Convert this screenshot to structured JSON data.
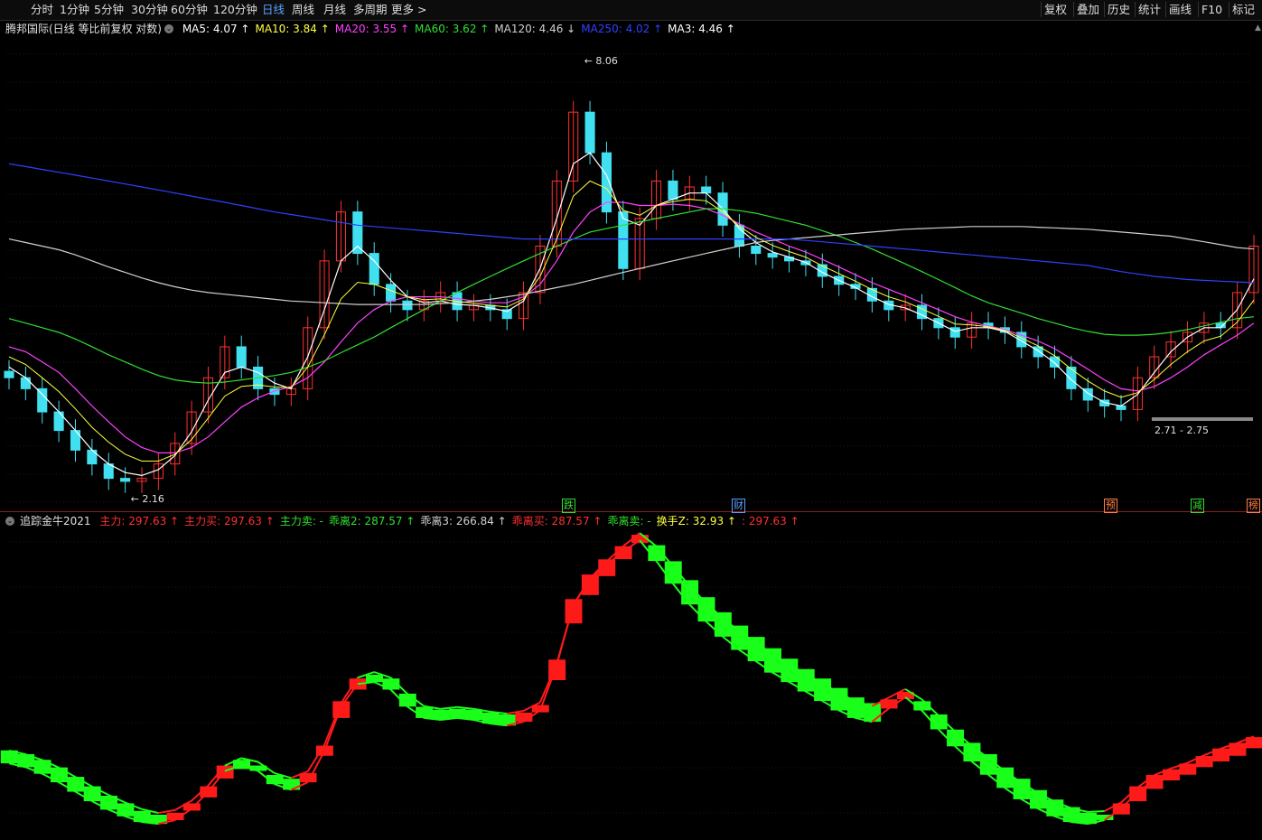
{
  "toolbar": {
    "periods": [
      "分时",
      "1分钟",
      "5分钟",
      "30分钟",
      "60分钟",
      "120分钟",
      "日线",
      "周线",
      "月线",
      "多周期",
      "更多 >"
    ],
    "active_period": "日线",
    "right_buttons": [
      "复权",
      "叠加",
      "历史",
      "统计",
      "画线",
      "F10",
      "标记"
    ]
  },
  "main_legend": {
    "title": "腾邦国际(日线 等比前复权 对数)",
    "items": [
      {
        "label": "MA5: 4.07",
        "arrow": "↑",
        "color": "#ffffff"
      },
      {
        "label": "MA10: 3.84",
        "arrow": "↑",
        "color": "#ffff40"
      },
      {
        "label": "MA20: 3.55",
        "arrow": "↑",
        "color": "#ff40ff"
      },
      {
        "label": "MA60: 3.62",
        "arrow": "↑",
        "color": "#30e030"
      },
      {
        "label": "MA120: 4.46",
        "arrow": "↓",
        "color": "#d0d0d0"
      },
      {
        "label": "MA250: 4.02",
        "arrow": "↑",
        "color": "#3040ff"
      },
      {
        "label": "MA3: 4.46",
        "arrow": "↑",
        "color": "#ffffff"
      }
    ]
  },
  "sub_legend": {
    "title": "追踪金牛2021",
    "items": [
      {
        "label": "主力: 297.63",
        "arrow": "↑",
        "color": "#ff3030"
      },
      {
        "label": "主力买: 297.63",
        "arrow": "↑",
        "color": "#ff3030"
      },
      {
        "label": "主力卖: -",
        "arrow": "",
        "color": "#30e030"
      },
      {
        "label": "乖离2: 287.57",
        "arrow": "↑",
        "color": "#30e030"
      },
      {
        "label": "乖离3: 266.84",
        "arrow": "↑",
        "color": "#d0d0d0"
      },
      {
        "label": "乖离买: 287.57",
        "arrow": "↑",
        "color": "#ff3030"
      },
      {
        "label": "乖离卖: -",
        "arrow": "",
        "color": "#30e030"
      },
      {
        "label": "换手Z: 32.93",
        "arrow": "↑",
        "color": "#ffff40"
      },
      {
        "label": ": 297.63",
        "arrow": "↑",
        "color": "#ff3030"
      }
    ]
  },
  "annotations": {
    "high": "8.06",
    "low": "2.16",
    "range": "2.71 - 2.75"
  },
  "event_marks": [
    {
      "label": "跌",
      "color": "#30e030"
    },
    {
      "label": "财",
      "color": "#5aa0ff"
    },
    {
      "label": "预",
      "color": "#ff8040"
    },
    {
      "label": "减",
      "color": "#30e030"
    },
    {
      "label": "榜",
      "color": "#ff8040"
    }
  ],
  "colors": {
    "up": "#ff3030",
    "down": "#40e0f0",
    "buy": "#ff1a1a",
    "sell": "#1aff1a"
  },
  "chart_data": {
    "type": "line",
    "title": "腾邦国际(日线 等比前复权 对数)",
    "price_ylim": [
      2.05,
      8.5
    ],
    "y_scale": "log",
    "high": 8.06,
    "low": 2.16,
    "series": [
      {
        "name": "close",
        "values": [
          3.0,
          2.9,
          2.7,
          2.55,
          2.4,
          2.3,
          2.2,
          2.18,
          2.2,
          2.3,
          2.45,
          2.7,
          3.0,
          3.3,
          3.1,
          2.9,
          2.85,
          2.9,
          3.5,
          4.3,
          5.0,
          4.4,
          4.0,
          3.8,
          3.7,
          3.8,
          3.9,
          3.7,
          3.75,
          3.7,
          3.6,
          3.9,
          4.5,
          5.5,
          6.8,
          6.0,
          5.0,
          4.2,
          4.9,
          5.5,
          5.2,
          5.4,
          5.3,
          4.8,
          4.5,
          4.4,
          4.35,
          4.3,
          4.25,
          4.1,
          4.0,
          3.95,
          3.8,
          3.7,
          3.75,
          3.6,
          3.5,
          3.4,
          3.55,
          3.5,
          3.45,
          3.3,
          3.2,
          3.1,
          2.9,
          2.8,
          2.75,
          2.72,
          3.0,
          3.2,
          3.35,
          3.45,
          3.55,
          3.5,
          3.9,
          4.5
        ]
      },
      {
        "name": "MA5",
        "values": [
          3.1,
          3.0,
          2.85,
          2.7,
          2.55,
          2.4,
          2.3,
          2.24,
          2.22,
          2.26,
          2.36,
          2.54,
          2.8,
          3.05,
          3.1,
          3.05,
          2.95,
          2.9,
          3.2,
          3.7,
          4.3,
          4.5,
          4.3,
          4.05,
          3.85,
          3.78,
          3.8,
          3.76,
          3.75,
          3.72,
          3.68,
          3.8,
          4.2,
          4.9,
          5.8,
          6.0,
          5.6,
          4.9,
          4.8,
          5.1,
          5.2,
          5.3,
          5.3,
          5.05,
          4.75,
          4.55,
          4.42,
          4.35,
          4.28,
          4.15,
          4.05,
          3.96,
          3.85,
          3.76,
          3.72,
          3.64,
          3.55,
          3.46,
          3.5,
          3.5,
          3.46,
          3.36,
          3.26,
          3.14,
          2.98,
          2.86,
          2.78,
          2.75,
          2.85,
          3.05,
          3.25,
          3.4,
          3.5,
          3.5,
          3.7,
          4.07
        ]
      },
      {
        "name": "MA20",
        "values": [
          3.3,
          3.25,
          3.15,
          3.05,
          2.9,
          2.75,
          2.62,
          2.5,
          2.42,
          2.38,
          2.38,
          2.42,
          2.5,
          2.62,
          2.74,
          2.82,
          2.88,
          2.92,
          3.0,
          3.15,
          3.35,
          3.55,
          3.7,
          3.8,
          3.85,
          3.85,
          3.85,
          3.83,
          3.8,
          3.78,
          3.78,
          3.85,
          4.0,
          4.3,
          4.7,
          5.0,
          5.15,
          5.15,
          5.1,
          5.1,
          5.12,
          5.1,
          5.05,
          4.95,
          4.82,
          4.7,
          4.6,
          4.5,
          4.42,
          4.32,
          4.22,
          4.12,
          4.02,
          3.94,
          3.86,
          3.78,
          3.7,
          3.62,
          3.56,
          3.52,
          3.48,
          3.42,
          3.36,
          3.28,
          3.18,
          3.08,
          2.98,
          2.9,
          2.88,
          2.92,
          3.0,
          3.1,
          3.22,
          3.32,
          3.42,
          3.55
        ]
      },
      {
        "name": "MA60",
        "values": [
          3.6,
          3.55,
          3.5,
          3.45,
          3.38,
          3.3,
          3.22,
          3.15,
          3.08,
          3.02,
          2.98,
          2.96,
          2.95,
          2.96,
          2.98,
          3.0,
          3.02,
          3.05,
          3.1,
          3.16,
          3.24,
          3.32,
          3.4,
          3.5,
          3.6,
          3.7,
          3.8,
          3.9,
          4.0,
          4.1,
          4.2,
          4.3,
          4.4,
          4.5,
          4.6,
          4.7,
          4.75,
          4.8,
          4.85,
          4.9,
          4.95,
          5.0,
          5.05,
          5.05,
          5.02,
          4.98,
          4.92,
          4.86,
          4.8,
          4.72,
          4.64,
          4.55,
          4.46,
          4.36,
          4.26,
          4.16,
          4.06,
          3.96,
          3.86,
          3.78,
          3.72,
          3.66,
          3.6,
          3.55,
          3.5,
          3.46,
          3.43,
          3.42,
          3.42,
          3.43,
          3.45,
          3.48,
          3.52,
          3.56,
          3.6,
          3.62
        ]
      },
      {
        "name": "MA120",
        "values": [
          4.6,
          4.55,
          4.5,
          4.45,
          4.38,
          4.3,
          4.22,
          4.15,
          4.08,
          4.02,
          3.97,
          3.93,
          3.9,
          3.88,
          3.86,
          3.84,
          3.82,
          3.8,
          3.79,
          3.78,
          3.77,
          3.76,
          3.76,
          3.76,
          3.76,
          3.76,
          3.77,
          3.78,
          3.8,
          3.82,
          3.85,
          3.88,
          3.92,
          3.96,
          4.0,
          4.05,
          4.1,
          4.15,
          4.2,
          4.25,
          4.3,
          4.35,
          4.4,
          4.45,
          4.5,
          4.55,
          4.58,
          4.6,
          4.62,
          4.64,
          4.66,
          4.68,
          4.7,
          4.72,
          4.74,
          4.75,
          4.76,
          4.77,
          4.78,
          4.78,
          4.78,
          4.78,
          4.77,
          4.76,
          4.75,
          4.74,
          4.72,
          4.7,
          4.68,
          4.66,
          4.64,
          4.6,
          4.56,
          4.52,
          4.48,
          4.46
        ]
      },
      {
        "name": "MA250",
        "values": [
          5.8,
          5.75,
          5.7,
          5.65,
          5.6,
          5.55,
          5.5,
          5.45,
          5.4,
          5.35,
          5.3,
          5.25,
          5.2,
          5.15,
          5.1,
          5.05,
          5.0,
          4.96,
          4.92,
          4.88,
          4.84,
          4.8,
          4.78,
          4.76,
          4.74,
          4.72,
          4.7,
          4.68,
          4.66,
          4.64,
          4.62,
          4.6,
          4.6,
          4.6,
          4.6,
          4.6,
          4.6,
          4.6,
          4.6,
          4.6,
          4.6,
          4.6,
          4.6,
          4.6,
          4.6,
          4.6,
          4.6,
          4.6,
          4.58,
          4.56,
          4.54,
          4.52,
          4.5,
          4.48,
          4.46,
          4.44,
          4.42,
          4.4,
          4.38,
          4.36,
          4.34,
          4.32,
          4.3,
          4.28,
          4.26,
          4.24,
          4.2,
          4.16,
          4.13,
          4.1,
          4.08,
          4.06,
          4.05,
          4.04,
          4.03,
          4.02
        ]
      }
    ],
    "indicator": {
      "name": "追踪金牛2021",
      "ylim": [
        0,
        320
      ],
      "main": [
        90,
        86,
        80,
        72,
        62,
        52,
        42,
        34,
        26,
        22,
        24,
        32,
        46,
        66,
        76,
        74,
        64,
        60,
        66,
        90,
        130,
        160,
        170,
        166,
        150,
        136,
        133,
        134,
        133,
        130,
        128,
        130,
        136,
        170,
        230,
        260,
        280,
        298,
        315,
        307,
        290,
        270,
        252,
        236,
        222,
        210,
        198,
        187,
        176,
        166,
        156,
        146,
        140,
        144,
        150,
        142,
        128,
        112,
        98,
        86,
        72,
        60,
        48,
        38,
        30,
        24,
        22,
        28,
        42,
        55,
        64,
        70,
        78,
        84,
        90,
        98
      ],
      "line2": [
        82,
        78,
        71,
        62,
        52,
        42,
        33,
        26,
        20,
        18,
        22,
        34,
        52,
        74,
        80,
        74,
        60,
        54,
        62,
        95,
        142,
        166,
        168,
        160,
        142,
        130,
        128,
        130,
        128,
        124,
        122,
        126,
        138,
        186,
        250,
        276,
        292,
        306,
        318,
        296,
        272,
        250,
        232,
        216,
        202,
        190,
        178,
        168,
        158,
        148,
        138,
        130,
        126,
        140,
        152,
        138,
        118,
        100,
        84,
        70,
        56,
        44,
        34,
        26,
        20,
        18,
        22,
        34,
        52,
        64,
        70,
        76,
        84,
        92,
        98,
        104
      ],
      "line3": [
        86,
        82,
        76,
        68,
        58,
        48,
        39,
        31,
        24,
        20,
        23,
        33,
        49,
        70,
        78,
        74,
        62,
        57,
        64,
        92,
        136,
        163,
        169,
        163,
        146,
        133,
        130,
        132,
        130,
        127,
        125,
        128,
        137,
        178,
        240,
        268,
        286,
        302,
        316,
        302,
        281,
        260,
        242,
        226,
        212,
        200,
        188,
        177,
        167,
        157,
        147,
        138,
        133,
        142,
        151,
        140,
        123,
        106,
        91,
        78,
        64,
        52,
        41,
        32,
        25,
        21,
        22,
        31,
        47,
        60,
        67,
        73,
        81,
        88,
        94,
        101
      ],
      "signal": [
        "sell",
        "sell",
        "sell",
        "sell",
        "sell",
        "sell",
        "sell",
        "sell",
        "sell",
        "sell",
        "buy",
        "buy",
        "buy",
        "buy",
        "sell",
        "sell",
        "sell",
        "sell",
        "buy",
        "buy",
        "buy",
        "buy",
        "sell",
        "sell",
        "sell",
        "sell",
        "sell",
        "sell",
        "sell",
        "sell",
        "sell",
        "buy",
        "buy",
        "buy",
        "buy",
        "buy",
        "buy",
        "buy",
        "buy",
        "sell",
        "sell",
        "sell",
        "sell",
        "sell",
        "sell",
        "sell",
        "sell",
        "sell",
        "sell",
        "sell",
        "sell",
        "sell",
        "sell",
        "buy",
        "buy",
        "sell",
        "sell",
        "sell",
        "sell",
        "sell",
        "sell",
        "sell",
        "sell",
        "sell",
        "sell",
        "sell",
        "sell",
        "buy",
        "buy",
        "buy",
        "buy",
        "buy",
        "buy",
        "buy",
        "buy",
        "buy"
      ]
    }
  }
}
